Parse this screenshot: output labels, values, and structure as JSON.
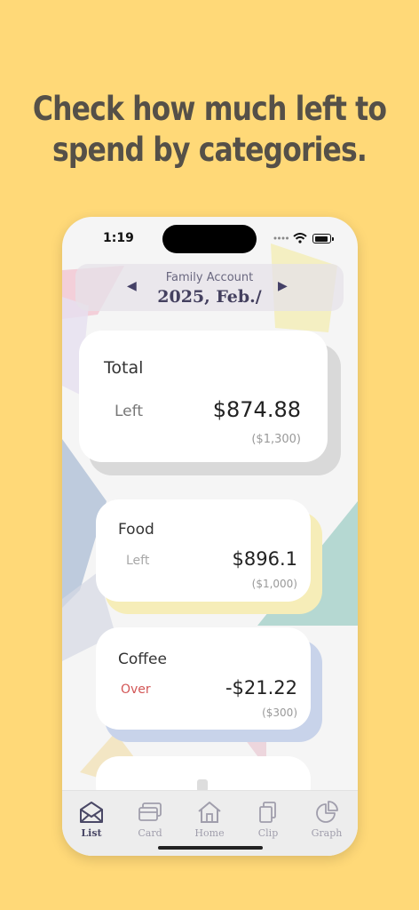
{
  "headline": {
    "line1": "Check how much left to",
    "line2": "spend by categories."
  },
  "status": {
    "time": "1:19"
  },
  "header": {
    "account": "Family Account",
    "month": "2025, Feb./",
    "prev_icon": "◀",
    "next_icon": "▶"
  },
  "total": {
    "title": "Total",
    "label": "Left",
    "amount": "$874.88",
    "budget": "($1,300)"
  },
  "categories": [
    {
      "title": "Food",
      "label": "Left",
      "amount": "$896.1",
      "budget": "($1,000)",
      "label_color": "#A8A8A8"
    },
    {
      "title": "Coffee",
      "label": "Over",
      "amount": "-$21.22",
      "budget": "($300)",
      "label_color": "#D25656"
    }
  ],
  "tabs": [
    {
      "label": "List",
      "icon": "envelope-icon",
      "active": true
    },
    {
      "label": "Card",
      "icon": "card-icon",
      "active": false
    },
    {
      "label": "Home",
      "icon": "home-icon",
      "active": false
    },
    {
      "label": "Clip",
      "icon": "clip-icon",
      "active": false
    },
    {
      "label": "Graph",
      "icon": "pie-chart-icon",
      "active": false
    }
  ],
  "colors": {
    "background": "#FFD978",
    "over": "#D25656",
    "accent": "#44405F"
  }
}
